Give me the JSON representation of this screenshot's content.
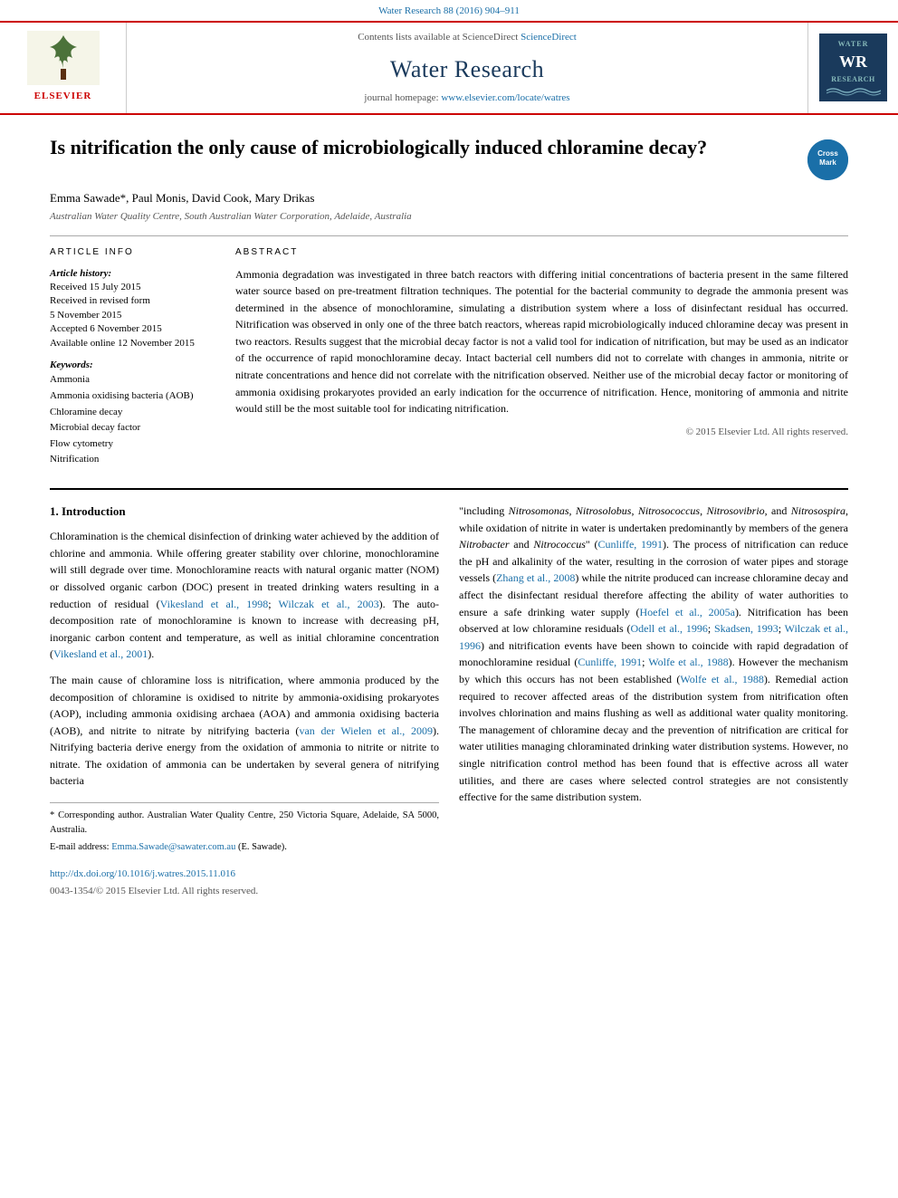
{
  "banner": {
    "journal_ref": "Water Research 88 (2016) 904–911"
  },
  "journal_header": {
    "sciencedirect": "Contents lists available at ScienceDirect",
    "journal_title": "Water Research",
    "homepage_label": "journal homepage:",
    "homepage_url": "www.elsevier.com/locate/watres",
    "elsevier_label": "ELSEVIER",
    "wr_logo_top": "WATER",
    "wr_logo_mid": "WR",
    "wr_logo_bot": "RESEARCH"
  },
  "article": {
    "title": "Is nitrification the only cause of microbiologically induced chloramine decay?",
    "authors": "Emma Sawade*, Paul Monis, David Cook, Mary Drikas",
    "affiliation": "Australian Water Quality Centre, South Australian Water Corporation, Adelaide, Australia",
    "crossmark": "CrossMark"
  },
  "article_info": {
    "heading": "ARTICLE INFO",
    "history_label": "Article history:",
    "received": "Received 15 July 2015",
    "revised": "Received in revised form\n5 November 2015",
    "accepted": "Accepted 6 November 2015",
    "available": "Available online 12 November 2015",
    "keywords_label": "Keywords:",
    "keywords": [
      "Ammonia",
      "Ammonia oxidising bacteria (AOB)",
      "Chloramine decay",
      "Microbial decay factor",
      "Flow cytometry",
      "Nitrification"
    ]
  },
  "abstract": {
    "heading": "ABSTRACT",
    "text": "Ammonia degradation was investigated in three batch reactors with differing initial concentrations of bacteria present in the same filtered water source based on pre-treatment filtration techniques. The potential for the bacterial community to degrade the ammonia present was determined in the absence of monochloramine, simulating a distribution system where a loss of disinfectant residual has occurred. Nitrification was observed in only one of the three batch reactors, whereas rapid microbiologically induced chloramine decay was present in two reactors. Results suggest that the microbial decay factor is not a valid tool for indication of nitrification, but may be used as an indicator of the occurrence of rapid monochloramine decay. Intact bacterial cell numbers did not to correlate with changes in ammonia, nitrite or nitrate concentrations and hence did not correlate with the nitrification observed. Neither use of the microbial decay factor or monitoring of ammonia oxidising prokaryotes provided an early indication for the occurrence of nitrification. Hence, monitoring of ammonia and nitrite would still be the most suitable tool for indicating nitrification.",
    "copyright": "© 2015 Elsevier Ltd. All rights reserved."
  },
  "intro": {
    "section_num": "1.",
    "section_title": "Introduction",
    "para1": "Chloramination is the chemical disinfection of drinking water achieved by the addition of chlorine and ammonia. While offering greater stability over chlorine, monochloramine will still degrade over time. Monochloramine reacts with natural organic matter (NOM) or dissolved organic carbon (DOC) present in treated drinking waters resulting in a reduction of residual (Vikesland et al., 1998; Wilczak et al., 2003). The auto-decomposition rate of monochloramine is known to increase with decreasing pH, inorganic carbon content and temperature, as well as initial chloramine concentration (Vikesland et al., 2001).",
    "para2": "The main cause of chloramine loss is nitrification, where ammonia produced by the decomposition of chloramine is oxidised to nitrite by ammonia-oxidising prokaryotes (AOP), including ammonia oxidising archaea (AOA) and ammonia oxidising bacteria (AOB), and nitrite to nitrate by nitrifying bacteria (van der Wielen et al., 2009). Nitrifying bacteria derive energy from the oxidation of ammonia to nitrite or nitrite to nitrate. The oxidation of ammonia can be undertaken by several genera of nitrifying bacteria"
  },
  "right_col": {
    "para1": "\"including Nitrosomonas, Nitrosolobus, Nitrosococcus, Nitrosovibrio, and Nitrosospira, while oxidation of nitrite in water is undertaken predominantly by members of the genera Nitrobacter and Nitrococcus\" (Cunliffe, 1991). The process of nitrification can reduce the pH and alkalinity of the water, resulting in the corrosion of water pipes and storage vessels (Zhang et al., 2008) while the nitrite produced can increase chloramine decay and affect the disinfectant residual therefore affecting the ability of water authorities to ensure a safe drinking water supply (Hoefel et al., 2005a). Nitrification has been observed at low chloramine residuals (Odell et al., 1996; Skadsen, 1993; Wilczak et al., 1996) and nitrification events have been shown to coincide with rapid degradation of monochloramine residual (Cunliffe, 1991; Wolfe et al., 1988). However the mechanism by which this occurs has not been established (Wolfe et al., 1988). Remedial action required to recover affected areas of the distribution system from nitrification often involves chlorination and mains flushing as well as additional water quality monitoring. The management of chloramine decay and the prevention of nitrification are critical for water utilities managing chloraminated drinking water distribution systems. However, no single nitrification control method has been found that is effective across all water utilities, and there are cases where selected control strategies are not consistently effective for the same distribution system."
  },
  "footnotes": {
    "corresponding": "* Corresponding author. Australian Water Quality Centre, 250 Victoria Square, Adelaide, SA 5000, Australia.",
    "email_label": "E-mail address:",
    "email": "Emma.Sawade@sawater.com.au",
    "email_suffix": "(E. Sawade)."
  },
  "doi": {
    "url": "http://dx.doi.org/10.1016/j.watres.2015.11.016",
    "issn": "0043-1354/© 2015 Elsevier Ltd. All rights reserved."
  }
}
